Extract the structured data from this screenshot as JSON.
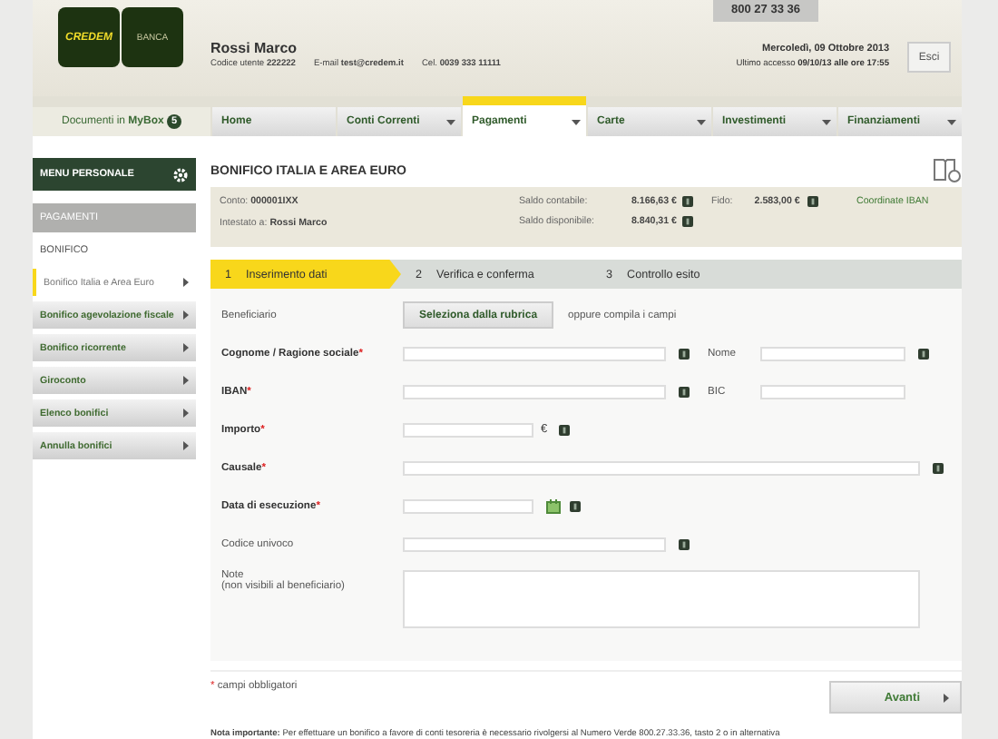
{
  "header": {
    "logo": {
      "left": "CREDEM",
      "right": "BANCA"
    },
    "phone": "800 27 33 36",
    "user_name": "Rossi Marco",
    "user_details": [
      {
        "label": "Codice utente",
        "value": "222222"
      },
      {
        "label": "E-mail",
        "value": "test@credem.it"
      },
      {
        "label": "Cel.",
        "value": "0039 333 11111"
      }
    ],
    "date": "Mercoledì, 09 Ottobre 2013",
    "last_access": {
      "label": "Ultimo accesso",
      "value": "09/10/13 alle ore 17:55"
    },
    "logout": "Esci"
  },
  "nav": {
    "mybox": {
      "label": "Documenti in",
      "strong": "MyBox",
      "count": "5"
    },
    "tabs": [
      {
        "label": "Home",
        "selected": false,
        "dropdown": false
      },
      {
        "label": "Conti Correnti",
        "selected": false,
        "dropdown": true
      },
      {
        "label": "Pagamenti",
        "selected": true,
        "dropdown": true
      },
      {
        "label": "Carte",
        "selected": false,
        "dropdown": true
      },
      {
        "label": "Investimenti",
        "selected": false,
        "dropdown": true
      },
      {
        "label": "Finanziamenti",
        "selected": false,
        "dropdown": true
      }
    ]
  },
  "sidebar": {
    "menu_title": "MENU PERSONALE",
    "section": "PAGAMENTI",
    "group": "BONIFICO",
    "items": [
      {
        "label": "Bonifico Italia e Area Euro",
        "selected": true
      },
      {
        "label": "Bonifico agevolazione fiscale",
        "selected": false
      },
      {
        "label": "Bonifico ricorrente",
        "selected": false
      },
      {
        "label": "Giroconto",
        "selected": false
      },
      {
        "label": "Elenco bonifici",
        "selected": false
      },
      {
        "label": "Annulla bonifici",
        "selected": false
      }
    ]
  },
  "main": {
    "title": "BONIFICO ITALIA E AREA EURO",
    "account": {
      "conto_label": "Conto:",
      "conto": "000001IXX",
      "holder_label": "Intestato a:",
      "holder": "Rossi Marco",
      "balances": [
        {
          "label": "Saldo contabile:",
          "value": "8.166,63 €"
        },
        {
          "label": "Saldo disponibile:",
          "value": "8.840,31 €"
        }
      ],
      "fido_label": "Fido:",
      "fido": "2.583,00 €",
      "iban_link": "Coordinate IBAN"
    },
    "steps": [
      {
        "number": "1",
        "label": "Inserimento dati",
        "selected": true
      },
      {
        "number": "2",
        "label": "Verifica e conferma",
        "selected": false
      },
      {
        "number": "3",
        "label": "Controllo esito",
        "selected": false
      }
    ],
    "fields": [
      {
        "kind": "rubrica",
        "label": "Beneficiario",
        "button": "Seleziona dalla rubrica",
        "hint": "oppure compila i campi"
      },
      {
        "kind": "text",
        "label": "Cognome / Ragione sociale",
        "mark": "*",
        "help": true,
        "side": {
          "label": "Nome",
          "help": true
        }
      },
      {
        "kind": "text",
        "label": "IBAN",
        "mark": "*",
        "help": true,
        "side": {
          "label": "BIC",
          "help": false
        }
      },
      {
        "kind": "amount",
        "label": "Importo",
        "mark": "*",
        "unit": "€",
        "help": true
      },
      {
        "kind": "wide",
        "label": "Causale",
        "mark": "*",
        "help": true
      },
      {
        "kind": "date",
        "label": "Data di esecuzione",
        "mark": "*",
        "help": true
      },
      {
        "kind": "text",
        "label": "Codice univoco",
        "help": true
      },
      {
        "kind": "textarea",
        "label": "Note",
        "sublabel": "(non visibili al beneficiario)"
      }
    ],
    "required_note": {
      "mark": "*",
      "text": "campi obbligatori"
    },
    "next": "Avanti",
    "note": "**Nota importante:** Per effettuare un bonifico a favore di conti tesoreria è necessario rivolgersi al Numero Verde 800.27.33.36, tasto 2 o in alternativa"
  }
}
